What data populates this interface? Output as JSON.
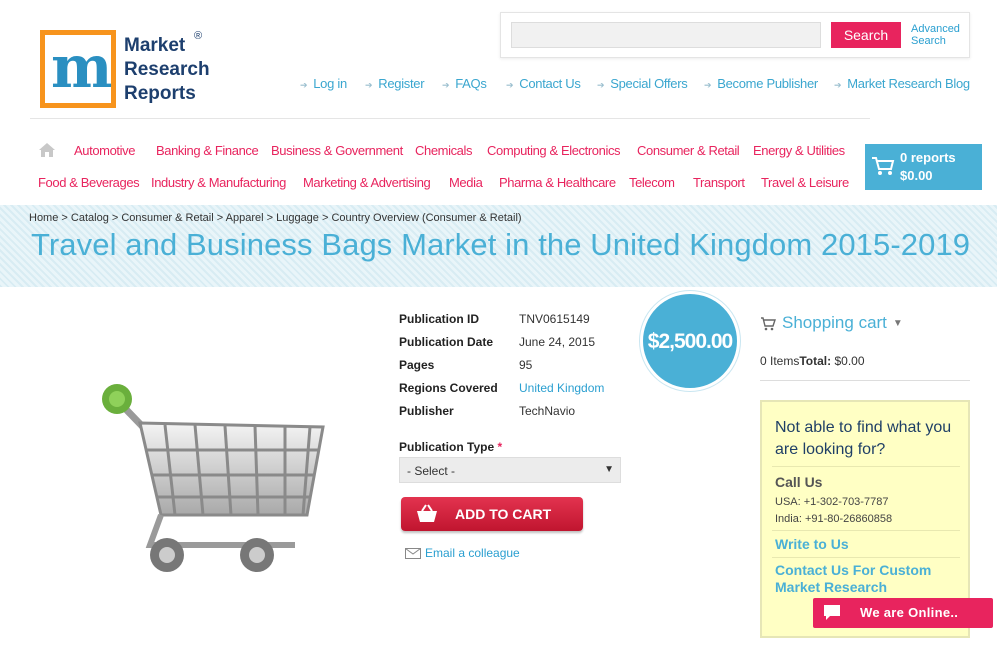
{
  "brand": {
    "logo_line1": "Market",
    "logo_line2": "Research",
    "logo_line3": "Reports",
    "registered": "®"
  },
  "search": {
    "placeholder": "",
    "button_label": "Search",
    "advanced_line1": "Advanced",
    "advanced_line2": "Search"
  },
  "top_nav": [
    "Log in",
    "Register",
    "FAQs",
    "Contact Us",
    "Special Offers",
    "Become Publisher",
    "Market Research Blog"
  ],
  "categories_row1": [
    "Automotive",
    "Banking & Finance",
    "Business & Government",
    "Chemicals",
    "Computing & Electronics",
    "Consumer & Retail",
    "Energy & Utilities"
  ],
  "categories_row2": [
    "Food & Beverages",
    "Industry & Manufacturing",
    "Marketing & Advertising",
    "Media",
    "Pharma & Healthcare",
    "Telecom",
    "Transport",
    "Travel & Leisure"
  ],
  "cart": {
    "count_label": "0 reports",
    "total_label": "$0.00"
  },
  "breadcrumb": [
    "Home",
    "Catalog",
    "Consumer & Retail",
    "Apparel",
    "Luggage",
    "Country Overview (Consumer & Retail)"
  ],
  "breadcrumb_sep": " > ",
  "page_title": "Travel and Business Bags Market in the United Kingdom 2015-2019",
  "details": {
    "publication_id_label": "Publication ID",
    "publication_id": "TNV0615149",
    "publication_date_label": "Publication Date",
    "publication_date": "June 24, 2015",
    "pages_label": "Pages",
    "pages": "95",
    "regions_label": "Regions Covered",
    "regions": "United Kingdom",
    "publisher_label": "Publisher",
    "publisher": "TechNavio"
  },
  "price": "$2,500.00",
  "publication_type": {
    "label": "Publication Type",
    "required_mark": "*",
    "selected": "- Select -"
  },
  "add_to_cart_label": "ADD TO CART",
  "email_colleague_label": "Email a colleague",
  "shopping_cart": {
    "heading": "Shopping cart",
    "items_text": "0 Items",
    "total_label": "Total:",
    "total_value": "$0.00"
  },
  "help": {
    "question": "Not able to find what you are looking for?",
    "call_us": "Call Us",
    "phone_usa": "USA: +1-302-703-7787",
    "phone_india": "India: +91-80-26860858",
    "write_to_us": "Write to Us",
    "custom_research": "Contact Us For Custom Market Research"
  },
  "online_chat_label": "We are Online..",
  "colors": {
    "accent_pink": "#e8245e",
    "accent_blue": "#4ab0d6",
    "link_blue": "#2a9fd0",
    "help_bg": "#ffffc4"
  }
}
